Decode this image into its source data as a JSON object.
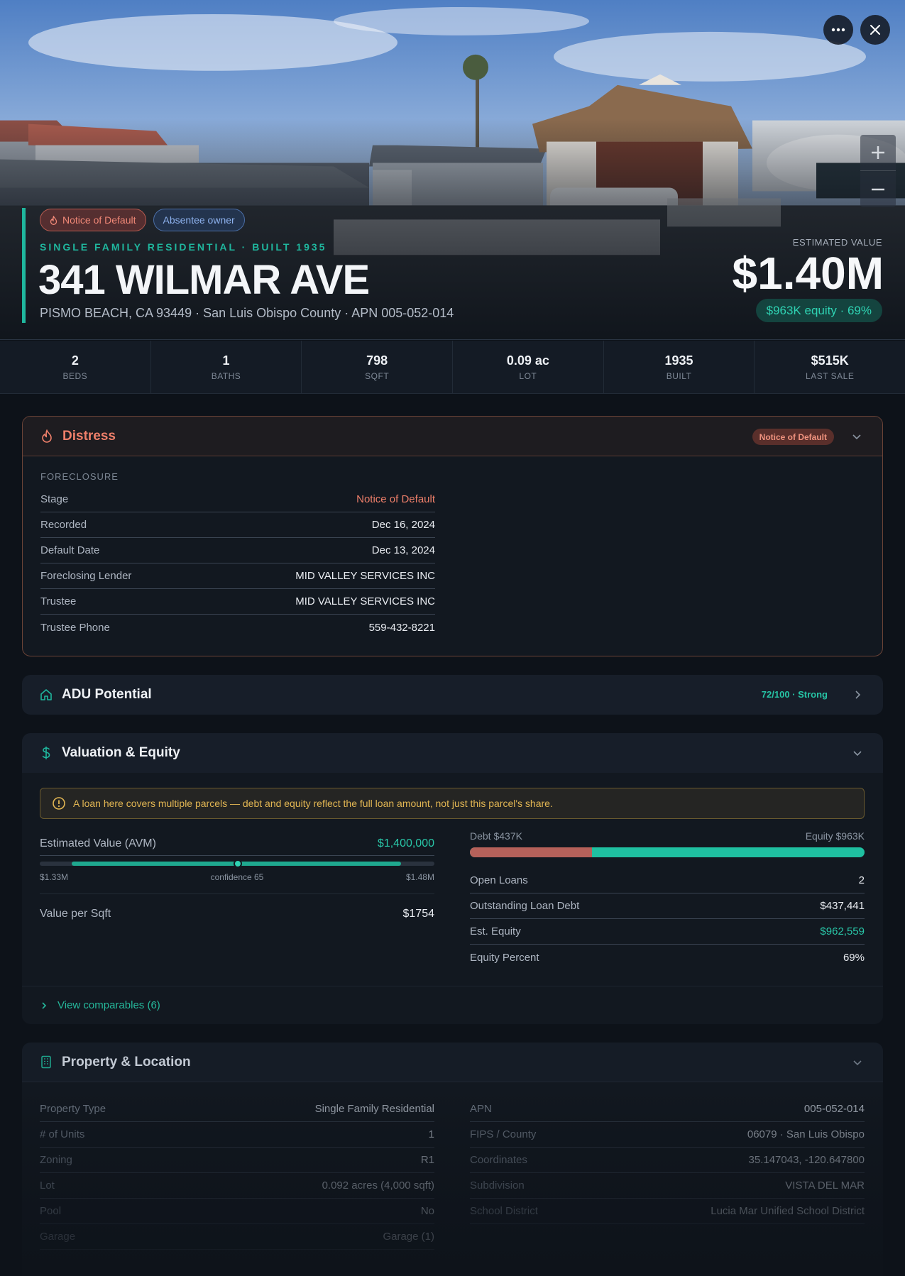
{
  "hero": {
    "tags": [
      "Notice of Default",
      "Absentee owner"
    ],
    "subtitle": "SINGLE FAMILY RESIDENTIAL · BUILT 1935",
    "title": "341 WILMAR AVE",
    "address": "PISMO BEACH, CA 93449 · San Luis Obispo County · APN 005-052-014",
    "est_label": "ESTIMATED VALUE",
    "est_value": "$1.40M",
    "equity_pill": "$963K equity · 69%"
  },
  "stats": [
    {
      "value": "2",
      "label": "BEDS"
    },
    {
      "value": "1",
      "label": "BATHS"
    },
    {
      "value": "798",
      "label": "SQFT"
    },
    {
      "value": "0.09 ac",
      "label": "LOT"
    },
    {
      "value": "1935",
      "label": "BUILT"
    },
    {
      "value": "$515K",
      "label": "LAST SALE"
    }
  ],
  "distress": {
    "title": "Distress",
    "badge": "Notice of Default",
    "caption": "FORECLOSURE",
    "rows": [
      {
        "key": "Stage",
        "value": "Notice of Default"
      },
      {
        "key": "Recorded",
        "value": "Dec 16, 2024"
      },
      {
        "key": "Default Date",
        "value": "Dec 13, 2024"
      },
      {
        "key": "Foreclosing Lender",
        "value": "MID VALLEY SERVICES INC"
      },
      {
        "key": "Trustee",
        "value": "MID VALLEY SERVICES INC"
      },
      {
        "key": "Trustee Phone",
        "value": "559-432-8221"
      }
    ]
  },
  "adu": {
    "title": "ADU Potential",
    "score": "72/100 · Strong"
  },
  "valuation": {
    "title": "Valuation & Equity",
    "warning": "A loan here covers multiple parcels — debt and equity reflect the full loan amount, not just this parcel's share.",
    "avm_label": "Estimated Value (AVM)",
    "avm_value": "$1,400,000",
    "range_low": "$1.33M",
    "range_mid": "confidence 65",
    "range_high": "$1.48M",
    "range_confidence": 0.65,
    "vps_label": "Value per Sqft",
    "vps_value": "$1754",
    "debt_label": "Debt $437K",
    "equity_label": "Equity $963K",
    "debt_fraction": 0.31,
    "rows": [
      {
        "key": "Open Loans",
        "value": "2"
      },
      {
        "key": "Outstanding Loan Debt",
        "value": "$437,441"
      },
      {
        "key": "Est. Equity",
        "value": "$962,559"
      },
      {
        "key": "Equity Percent",
        "value": "69%"
      }
    ],
    "comps_link": "View comparables (6)"
  },
  "property": {
    "title": "Property & Location",
    "left_rows": [
      {
        "key": "Property Type",
        "value": "Single Family Residential"
      },
      {
        "key": "# of Units",
        "value": "1"
      },
      {
        "key": "Zoning",
        "value": "R1"
      },
      {
        "key": "Lot",
        "value": "0.092 acres (4,000 sqft)"
      },
      {
        "key": "Pool",
        "value": "No"
      },
      {
        "key": "Garage",
        "value": "Garage (1)"
      }
    ],
    "right_rows": [
      {
        "key": "APN",
        "value": "005-052-014"
      },
      {
        "key": "FIPS / County",
        "value": "06079 · San Luis Obispo"
      },
      {
        "key": "Coordinates",
        "value": "35.147043, -120.647800"
      },
      {
        "key": "Subdivision",
        "value": "VISTA DEL MAR"
      },
      {
        "key": "School District",
        "value": "Lucia Mar Unified School District"
      }
    ]
  },
  "colors": {
    "accent": "#1fb79e",
    "distress": "#ee7f6a",
    "debt": "#b6615a",
    "warning": "#e2b653"
  }
}
